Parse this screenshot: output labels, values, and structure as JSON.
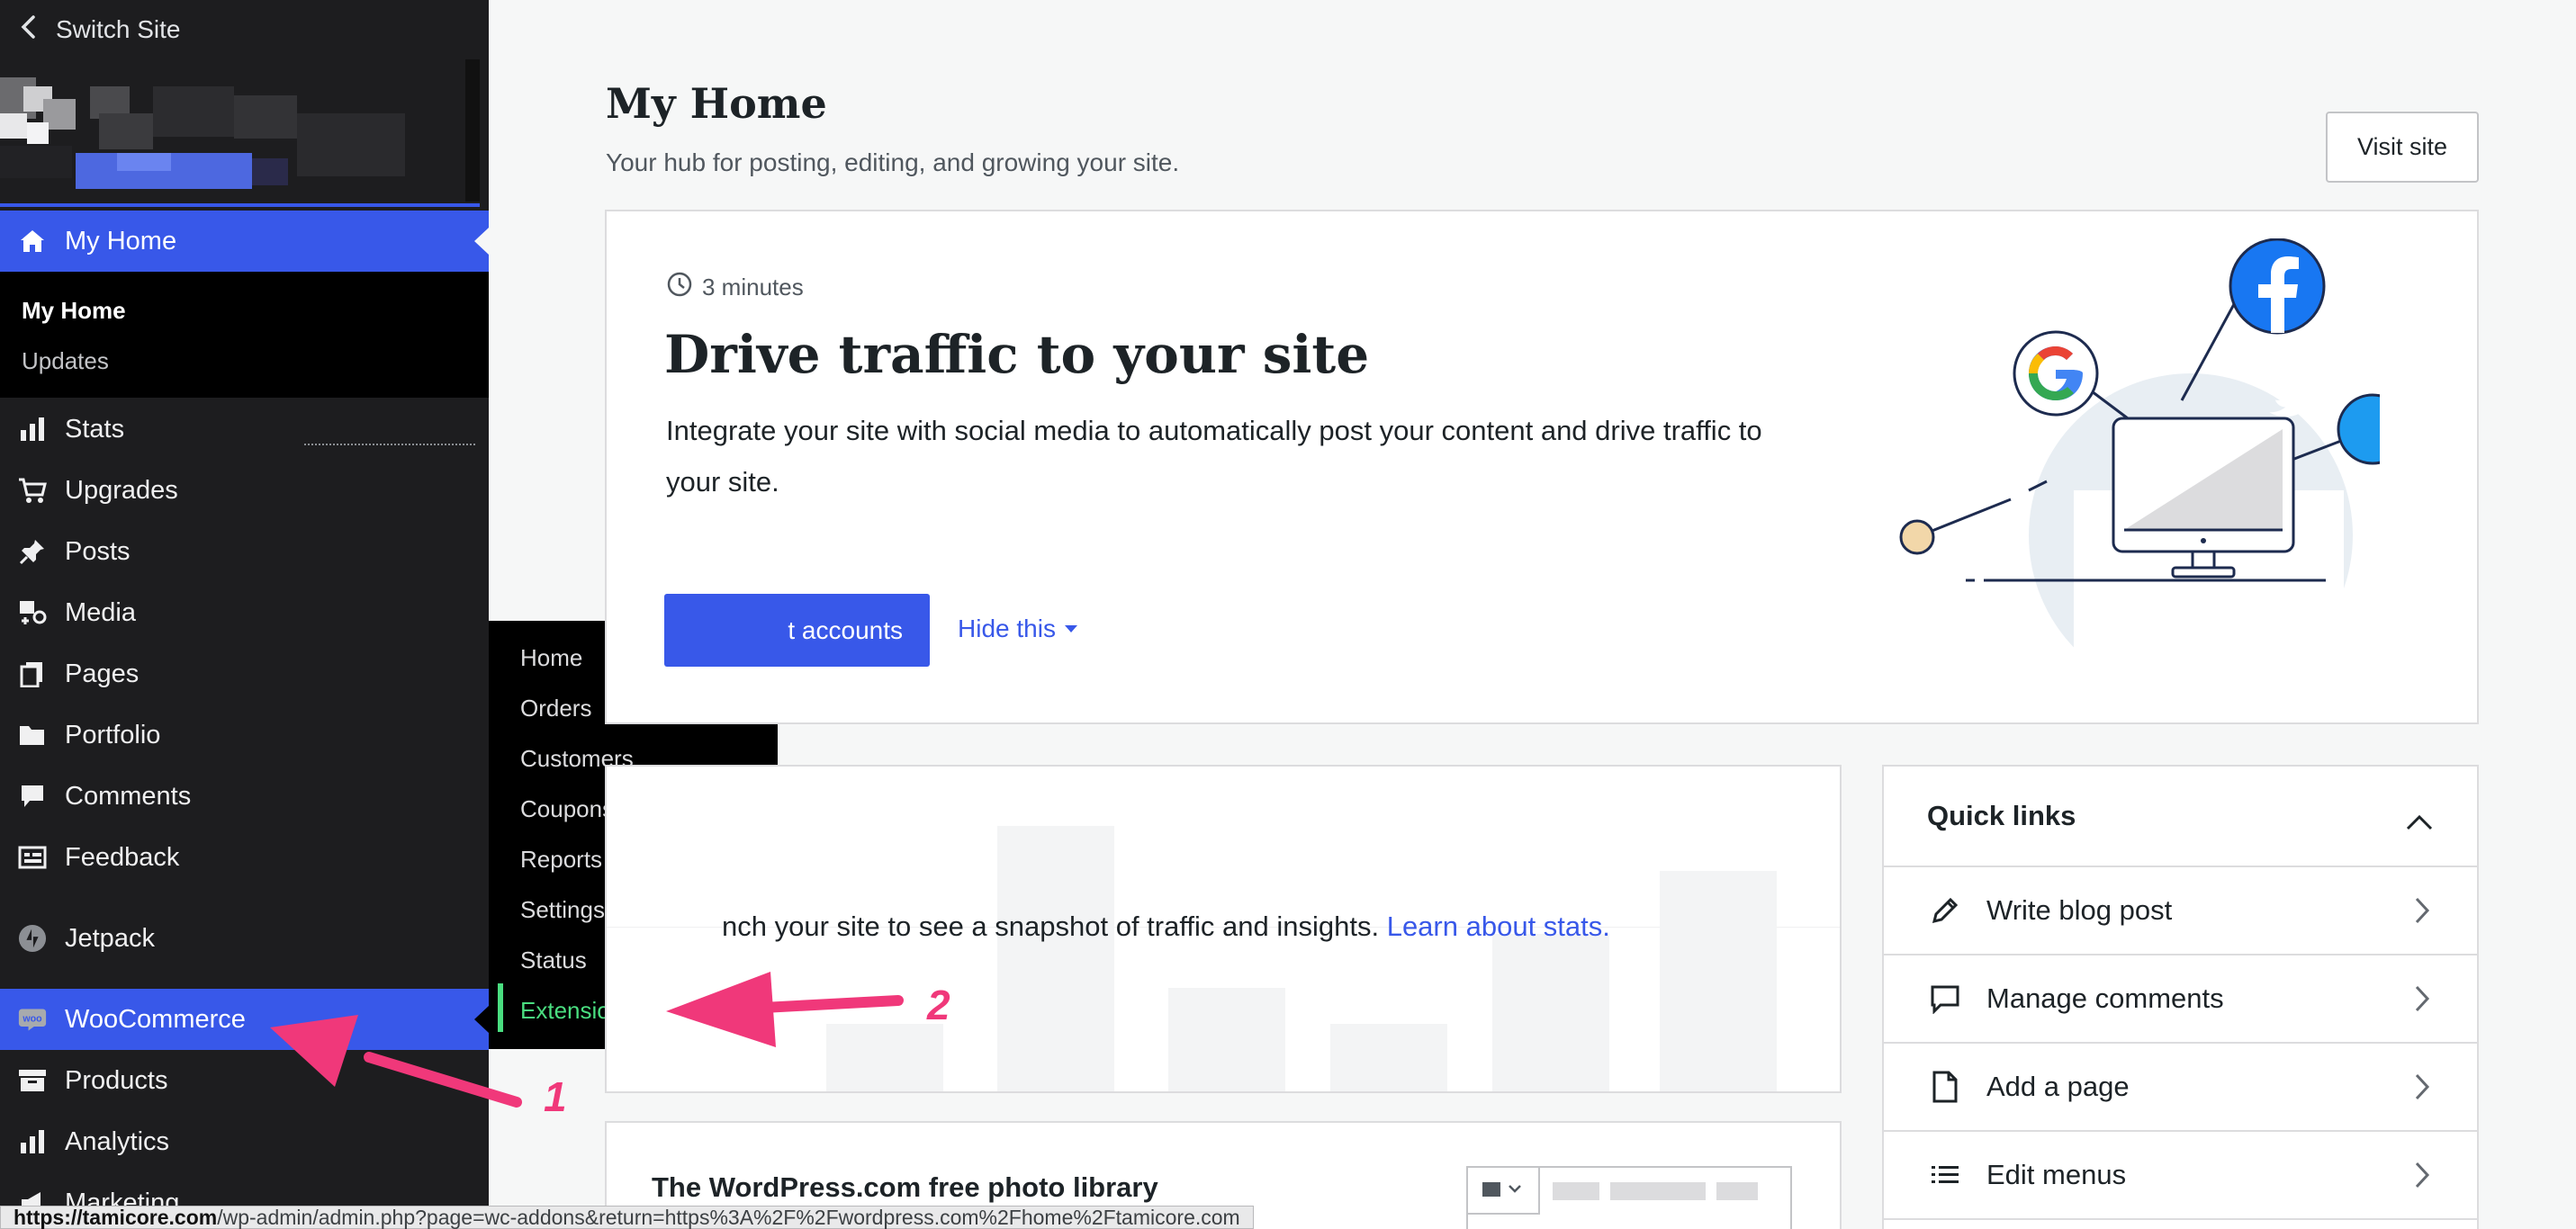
{
  "sidebar": {
    "switch_site": "Switch Site",
    "active_item": "My Home",
    "submenu": [
      "My Home",
      "Updates"
    ],
    "items": [
      {
        "label": "Stats",
        "icon": "stats-icon"
      },
      {
        "label": "Upgrades",
        "icon": "cart-icon"
      },
      {
        "label": "Posts",
        "icon": "pin-icon"
      },
      {
        "label": "Media",
        "icon": "media-icon"
      },
      {
        "label": "Pages",
        "icon": "pages-icon"
      },
      {
        "label": "Portfolio",
        "icon": "folder-icon"
      },
      {
        "label": "Comments",
        "icon": "comment-icon"
      },
      {
        "label": "Feedback",
        "icon": "feedback-icon"
      },
      {
        "label": "Jetpack",
        "icon": "jetpack-icon"
      },
      {
        "label": "WooCommerce",
        "icon": "woo-icon"
      },
      {
        "label": "Products",
        "icon": "archive-icon"
      },
      {
        "label": "Analytics",
        "icon": "analytics-icon"
      },
      {
        "label": "Marketing",
        "icon": "megaphone-icon"
      }
    ]
  },
  "flyout": {
    "items": [
      "Home",
      "Orders",
      "Customers",
      "Coupons",
      "Reports",
      "Settings",
      "Status",
      "Extensions"
    ],
    "current": "Extensions"
  },
  "header": {
    "title": "My Home",
    "subtitle": "Your hub for posting, editing, and growing your site.",
    "visit_site": "Visit site"
  },
  "traffic_card": {
    "time": "3 minutes",
    "title": "Drive traffic to your site",
    "description": "Integrate your site with social media to automatically post your content and drive traffic to your site.",
    "button": "Connect accounts",
    "button_visible": "t accounts",
    "hide": "Hide this"
  },
  "stats_card": {
    "message": "nch your site to see a snapshot of traffic and insights.",
    "link": "Learn about stats."
  },
  "photo_card": {
    "title": "The WordPress.com free photo library"
  },
  "quick_links": {
    "title": "Quick links",
    "items": [
      {
        "label": "Write blog post",
        "icon": "pencil-icon"
      },
      {
        "label": "Manage comments",
        "icon": "comment-icon"
      },
      {
        "label": "Add a page",
        "icon": "page-icon"
      },
      {
        "label": "Edit menus",
        "icon": "list-icon"
      }
    ]
  },
  "status_bar": {
    "host": "https://tamicore.com",
    "path": "/wp-admin/admin.php?page=wc-addons&return=https%3A%2F%2Fwordpress.com%2Fhome%2Ftamicore.com"
  },
  "annotations": {
    "one": "1",
    "two": "2"
  },
  "colors": {
    "accent": "#3858e9",
    "sidebar_bg": "#1d1d1f",
    "flyout_current": "#4ade80",
    "annotation": "#f0387a"
  }
}
